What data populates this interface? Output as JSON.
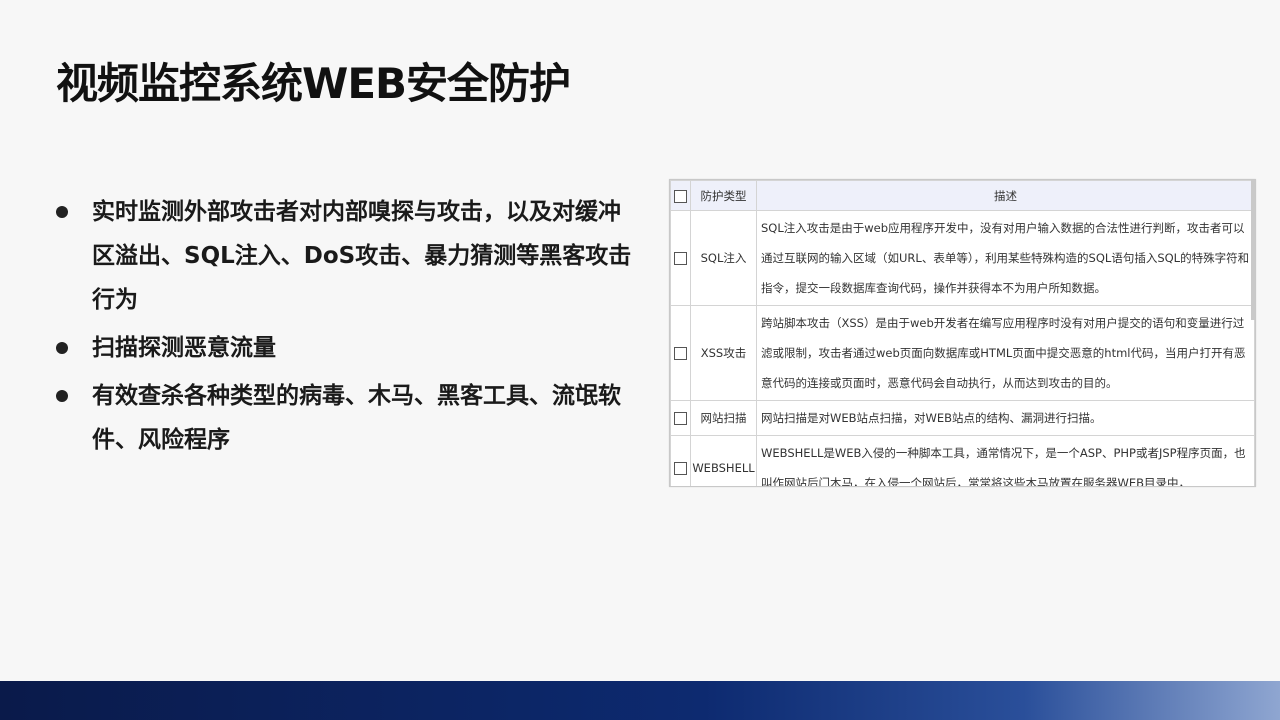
{
  "title": "视频监控系统WEB安全防护",
  "bullets": [
    "实时监测外部攻击者对内部嗅探与攻击，以及对缓冲区溢出、SQL注入、DoS攻击、暴力猜测等黑客攻击行为",
    "扫描探测恶意流量",
    "有效查杀各种类型的病毒、木马、黑客工具、流氓软件、风险程序"
  ],
  "table": {
    "headers": {
      "type": "防护类型",
      "desc": "描述"
    },
    "rows": [
      {
        "type": "SQL注入",
        "desc": "SQL注入攻击是由于web应用程序开发中，没有对用户输入数据的合法性进行判断，攻击者可以通过互联网的输入区域（如URL、表单等），利用某些特殊构造的SQL语句插入SQL的特殊字符和指令，提交一段数据库查询代码，操作并获得本不为用户所知数据。"
      },
      {
        "type": "XSS攻击",
        "desc": "跨站脚本攻击（XSS）是由于web开发者在编写应用程序时没有对用户提交的语句和变量进行过滤或限制，攻击者通过web页面向数据库或HTML页面中提交恶意的html代码，当用户打开有恶意代码的连接或页面时，恶意代码会自动执行，从而达到攻击的目的。"
      },
      {
        "type": "网站扫描",
        "desc": "网站扫描是对WEB站点扫描，对WEB站点的结构、漏洞进行扫描。"
      },
      {
        "type": "WEBSHELL",
        "desc": "WEBSHELL是WEB入侵的一种脚本工具，通常情况下，是一个ASP、PHP或者JSP程序页面，也叫作网站后门木马，在入侵一个网站后，常常将这些木马放置在服务器WEB目录中，"
      }
    ]
  },
  "colors": {
    "background": "#f7f7f7",
    "table_header": "#eef0fa",
    "bar_dark": "#0d2a70"
  }
}
